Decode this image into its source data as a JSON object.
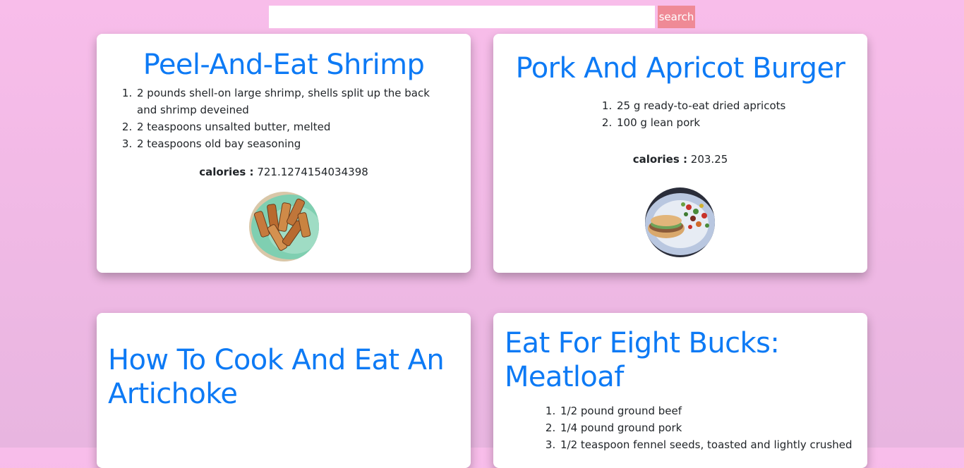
{
  "search": {
    "placeholder": "",
    "value": "",
    "button_label": "search"
  },
  "cards": [
    {
      "title": "Peel-And-Eat Shrimp",
      "ingredients": [
        "2 pounds shell-on large shrimp, shells split up the back and shrimp deveined",
        "2 teaspoons unsalted butter, melted",
        "2 teaspoons old bay seasoning"
      ],
      "calories_label": "calories :",
      "calories_value": "721.1274154034398",
      "image_icon": "fried-food-photo"
    },
    {
      "title": "Pork And Apricot Burger",
      "ingredients": [
        "25 g ready-to-eat dried apricots",
        "100 g lean pork"
      ],
      "calories_label": "calories :",
      "calories_value": "203.25",
      "image_icon": "burger-plate-photo"
    },
    {
      "title": "How To Cook And Eat An Artichoke",
      "ingredients": []
    },
    {
      "title": "Eat For Eight Bucks: Meatloaf",
      "ingredients": [
        "1/2 pound ground beef",
        "1/4 pound ground pork",
        "1/2 teaspoon fennel seeds, toasted and lightly crushed"
      ]
    }
  ],
  "colors": {
    "title": "#0d7af5",
    "search_button": "#ef8a96",
    "card_bg": "#ffffff"
  }
}
